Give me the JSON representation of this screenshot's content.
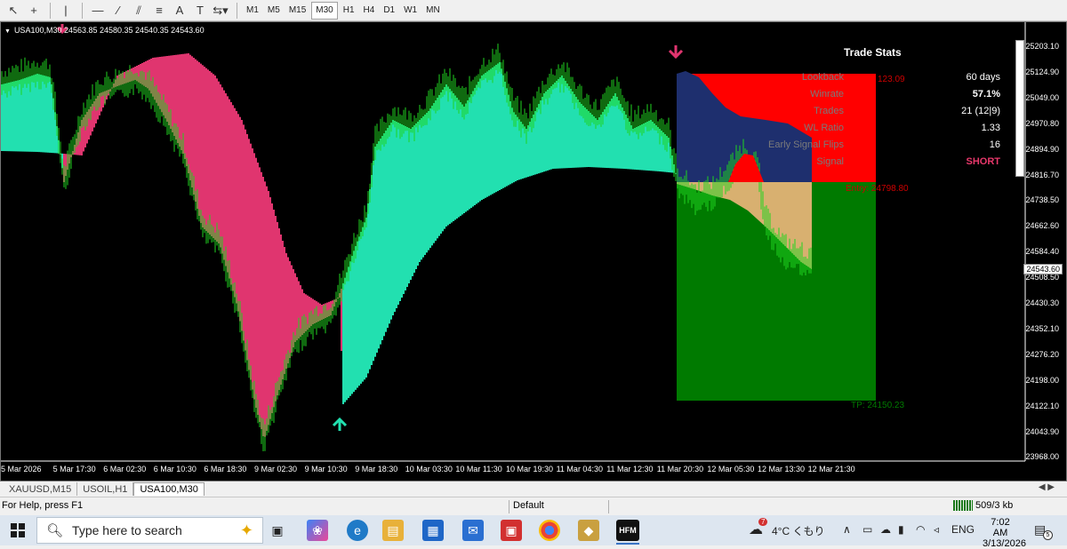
{
  "toolbar": {
    "tools": [
      "cursor-icon",
      "crosshair-icon",
      "vertical-line-icon",
      "horizontal-line-icon",
      "trend-line-icon",
      "equidistant-channel-icon",
      "fibonacci-icon",
      "text-icon",
      "text-label-icon",
      "arrows-icon"
    ],
    "timeframes": [
      "M1",
      "M5",
      "M15",
      "M30",
      "H1",
      "H4",
      "D1",
      "W1",
      "MN"
    ],
    "active_timeframe": "M30"
  },
  "chart": {
    "symbol_label": "USA100,M30  24563.85 24580.35 24540.35 24543.60",
    "current_price": "24543.60",
    "price_ticks": [
      "25203.10",
      "25124.90",
      "25049.00",
      "24970.80",
      "24894.90",
      "24816.70",
      "24738.50",
      "24662.60",
      "24584.40",
      "24508.50",
      "24430.30",
      "24352.10",
      "24276.20",
      "24198.00",
      "24122.10",
      "24043.90",
      "23968.00"
    ],
    "time_ticks": [
      "5 Mar 2026",
      "5 Mar 17:30",
      "6 Mar 02:30",
      "6 Mar 10:30",
      "6 Mar 18:30",
      "9 Mar 02:30",
      "9 Mar 10:30",
      "9 Mar 18:30",
      "10 Mar 03:30",
      "10 Mar 11:30",
      "10 Mar 19:30",
      "11 Mar 04:30",
      "11 Mar 12:30",
      "11 Mar 20:30",
      "12 Mar 05:30",
      "12 Mar 13:30",
      "12 Mar 21:30"
    ],
    "colors": {
      "bull": "#22e0b0",
      "bear": "#e0356f",
      "candle": "#1fd41f",
      "sl_zone": "#ff0000",
      "tp_zone": "#007a00",
      "entry_zone": "#d8b070",
      "trail_zone": "#1e2f6e"
    },
    "sl_label": "123.09",
    "entry_label": "Entry: 24798.80",
    "tp_label": "TP: 24150.23"
  },
  "stats": {
    "title": "Trade Stats",
    "rows": [
      {
        "label": "Lookback",
        "value": "60 days"
      },
      {
        "label": "Winrate",
        "value": "57.1%"
      },
      {
        "label": "Trades",
        "value": "21 (12|9)"
      },
      {
        "label": "WL Ratio",
        "value": "1.33"
      },
      {
        "label": "Early Signal Flips",
        "value": "16"
      },
      {
        "label": "Signal",
        "value": "SHORT"
      }
    ]
  },
  "tabs": [
    "XAUUSD,M15",
    "USOIL,H1",
    "USA100,M30"
  ],
  "active_tab": "USA100,M30",
  "statusbar": {
    "help": "For Help, press F1",
    "profile": "Default",
    "traffic": "509/3 kb"
  },
  "taskbar": {
    "search_placeholder": "Type here to search",
    "weather": "4°C くもり",
    "lang": "ENG",
    "time": "7:02 AM",
    "date": "3/13/2026",
    "notifications": "5",
    "weather_badge": "7"
  }
}
